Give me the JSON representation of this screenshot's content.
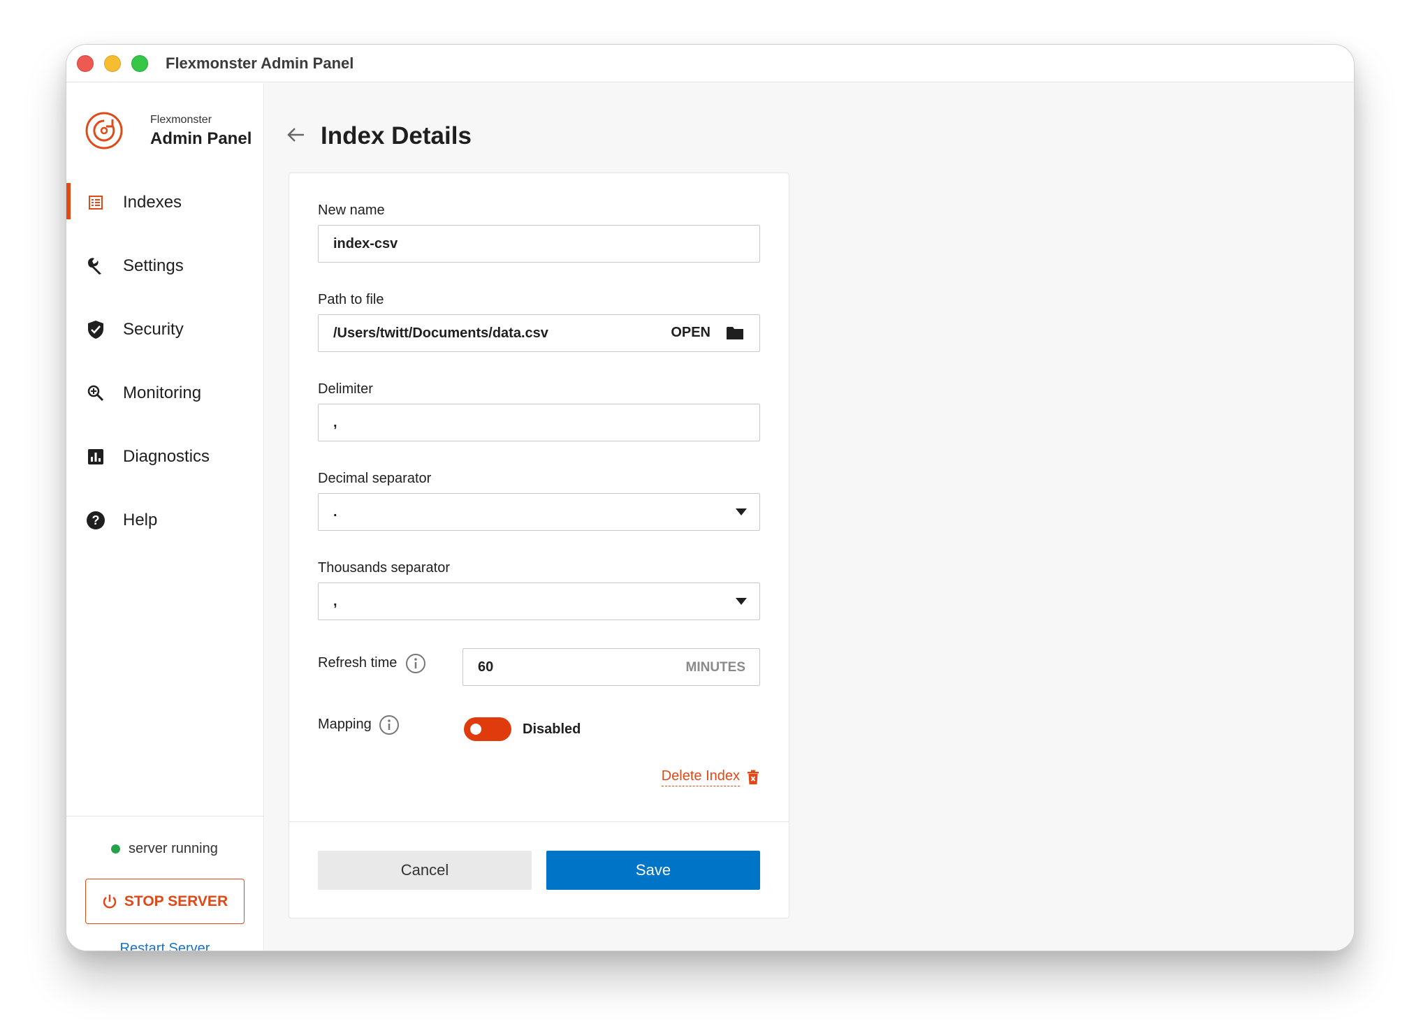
{
  "window": {
    "title": "Flexmonster Admin Panel"
  },
  "brand": {
    "small": "Flexmonster",
    "big": "Admin Panel",
    "accent": "#df4a16"
  },
  "sidebar": {
    "items": [
      {
        "label": "Indexes",
        "icon": "list-icon",
        "active": true
      },
      {
        "label": "Settings",
        "icon": "wrench-icon",
        "active": false
      },
      {
        "label": "Security",
        "icon": "shield-icon",
        "active": false
      },
      {
        "label": "Monitoring",
        "icon": "magnify-icon",
        "active": false
      },
      {
        "label": "Diagnostics",
        "icon": "bar-chart-icon",
        "active": false
      },
      {
        "label": "Help",
        "icon": "help-icon",
        "active": false
      }
    ],
    "status": "server running",
    "status_color": "#25a34a",
    "stop_label": "STOP SERVER",
    "restart_label": "Restart Server"
  },
  "page": {
    "title": "Index Details"
  },
  "form": {
    "new_name": {
      "label": "New name",
      "value": "index-csv"
    },
    "path": {
      "label": "Path to file",
      "value": "/Users/twitt/Documents/data.csv",
      "open_label": "OPEN"
    },
    "delimiter": {
      "label": "Delimiter",
      "value": ","
    },
    "decimal": {
      "label": "Decimal separator",
      "value": "."
    },
    "thousands": {
      "label": "Thousands separator",
      "value": ","
    },
    "refresh": {
      "label": "Refresh time",
      "value": "60",
      "unit": "MINUTES"
    },
    "mapping": {
      "label": "Mapping",
      "state": "Disabled"
    },
    "delete_label": "Delete Index",
    "cancel_label": "Cancel",
    "save_label": "Save",
    "save_color": "#0074c7"
  }
}
